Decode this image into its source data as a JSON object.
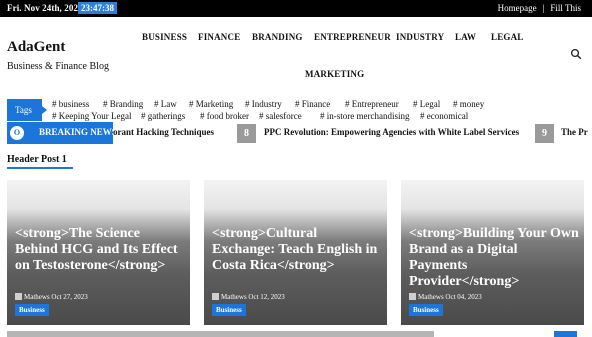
{
  "topbar": {
    "date": "Fri. Nov 24th, 2023",
    "clock": "23:47:38",
    "links": [
      "Homepage",
      "Fill This"
    ]
  },
  "brand": {
    "title": "AdaGent",
    "tagline": "Business & Finance Blog"
  },
  "nav": {
    "items": [
      "BUSINESS",
      "FINANCE",
      "BRANDING",
      "ENTREPRENEUR",
      "INDUSTRY",
      "LAW",
      "LEGAL",
      "MARKETING"
    ],
    "search_icon": "search-icon"
  },
  "tags": {
    "label": "Tags",
    "items": [
      "# business",
      "# Branding",
      "# Law",
      "# Marketing",
      "# Industry",
      "# Finance",
      "# Entrepreneur",
      "# Legal",
      "# money",
      "# Keeping Your Legal",
      "# gatherings",
      "# food broker",
      "# salesforce",
      "# in-store merchandising",
      "# economical"
    ]
  },
  "breaking": {
    "icon_text": "O",
    "label": "BREAKING NEWS",
    "ticker": [
      {
        "num": "",
        "text": "orant Hacking Techniques"
      },
      {
        "num": "8",
        "text": "PPC Revolution: Empowering Agencies with White Label Services"
      },
      {
        "num": "9",
        "text": "The Pr"
      }
    ]
  },
  "section": {
    "title": "Header Post 1"
  },
  "cards": [
    {
      "title": "<strong>The Science Behind HCG and Its Effect on Testosterone</strong>",
      "author": "Mathews",
      "date": "Oct 27, 2023",
      "category": "Business"
    },
    {
      "title": "<strong>Cultural Exchange: Teach English in Costa Rica</strong>",
      "author": "Mathews",
      "date": "Oct 12, 2023",
      "category": "Business"
    },
    {
      "title": "<strong>Building Your Own Brand as a Digital Payments Provider</strong>",
      "author": "Mathews",
      "date": "Oct 04, 2023",
      "category": "Business"
    }
  ],
  "colors": {
    "accent": "#1c75d8",
    "topbar": "#000000"
  }
}
